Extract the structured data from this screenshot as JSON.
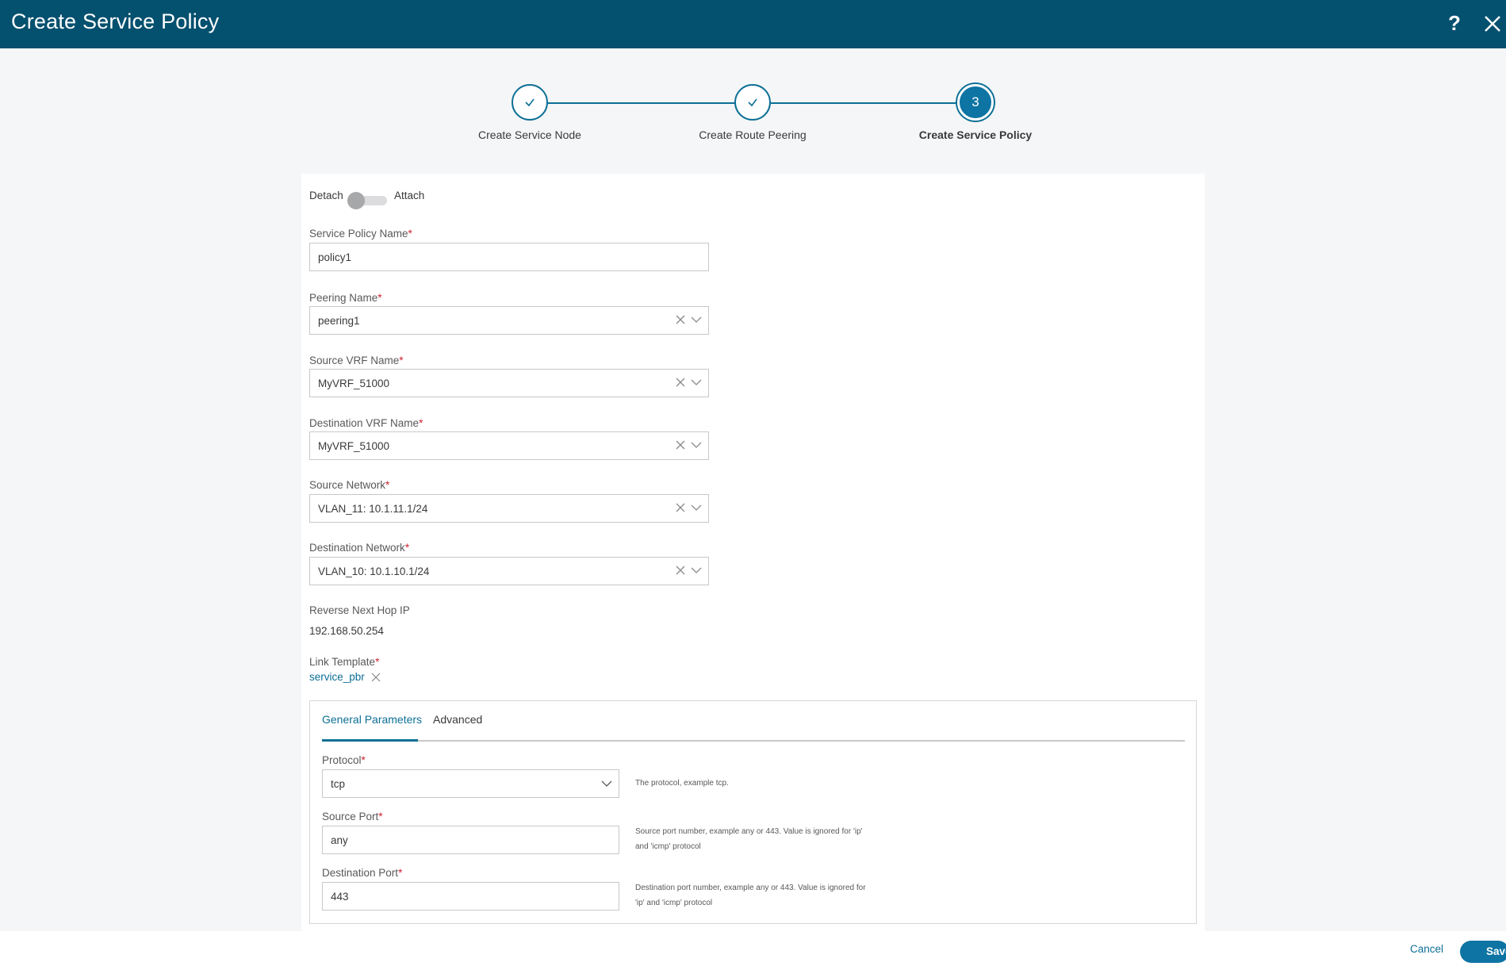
{
  "header": {
    "title": "Create Service Policy",
    "help_icon": "question-mark-icon",
    "close_icon": "close-icon"
  },
  "stepper": {
    "steps": [
      {
        "label": "Create Service Node",
        "state": "complete"
      },
      {
        "label": "Create Route Peering",
        "state": "complete"
      },
      {
        "label": "Create Service Policy",
        "state": "active",
        "number": "3"
      }
    ]
  },
  "form": {
    "toggle": {
      "left_label": "Detach",
      "right_label": "Attach",
      "value": "Detach"
    },
    "service_policy_name": {
      "label": "Service Policy Name",
      "required": "*",
      "value": "policy1"
    },
    "peering_name": {
      "label": "Peering Name",
      "required": "*",
      "value": "peering1"
    },
    "source_vrf": {
      "label": "Source VRF Name",
      "required": "*",
      "value": "MyVRF_51000"
    },
    "destination_vrf": {
      "label": "Destination VRF Name",
      "required": "*",
      "value": "MyVRF_51000"
    },
    "source_network": {
      "label": "Source Network",
      "required": "*",
      "value": "VLAN_11: 10.1.11.1/24"
    },
    "destination_network": {
      "label": "Destination Network",
      "required": "*",
      "value": "VLAN_10: 10.1.10.1/24"
    },
    "reverse_next_hop": {
      "label": "Reverse Next Hop IP",
      "value": "192.168.50.254"
    },
    "link_template": {
      "label": "Link Template",
      "required": "*",
      "value": "service_pbr"
    }
  },
  "tabs": {
    "items": [
      {
        "label": "General Parameters",
        "active": true
      },
      {
        "label": "Advanced",
        "active": false
      }
    ],
    "protocol": {
      "label": "Protocol",
      "required": "*",
      "value": "tcp",
      "help": "The protocol, example tcp."
    },
    "source_port": {
      "label": "Source Port",
      "required": "*",
      "value": "any",
      "help_line1": "Source port number, example any or 443. Value is ignored for 'ip'",
      "help_line2": "and 'icmp' protocol"
    },
    "destination_port": {
      "label": "Destination Port",
      "required": "*",
      "value": "443",
      "help_line1": "Destination port number, example any or 443. Value is ignored for",
      "help_line2": "'ip' and 'icmp' protocol"
    }
  },
  "footer": {
    "cancel_label": "Cancel",
    "save_label": "Save"
  },
  "colors": {
    "header_bg": "#04506f",
    "accent": "#0d74a3",
    "required": "#cf2030"
  }
}
